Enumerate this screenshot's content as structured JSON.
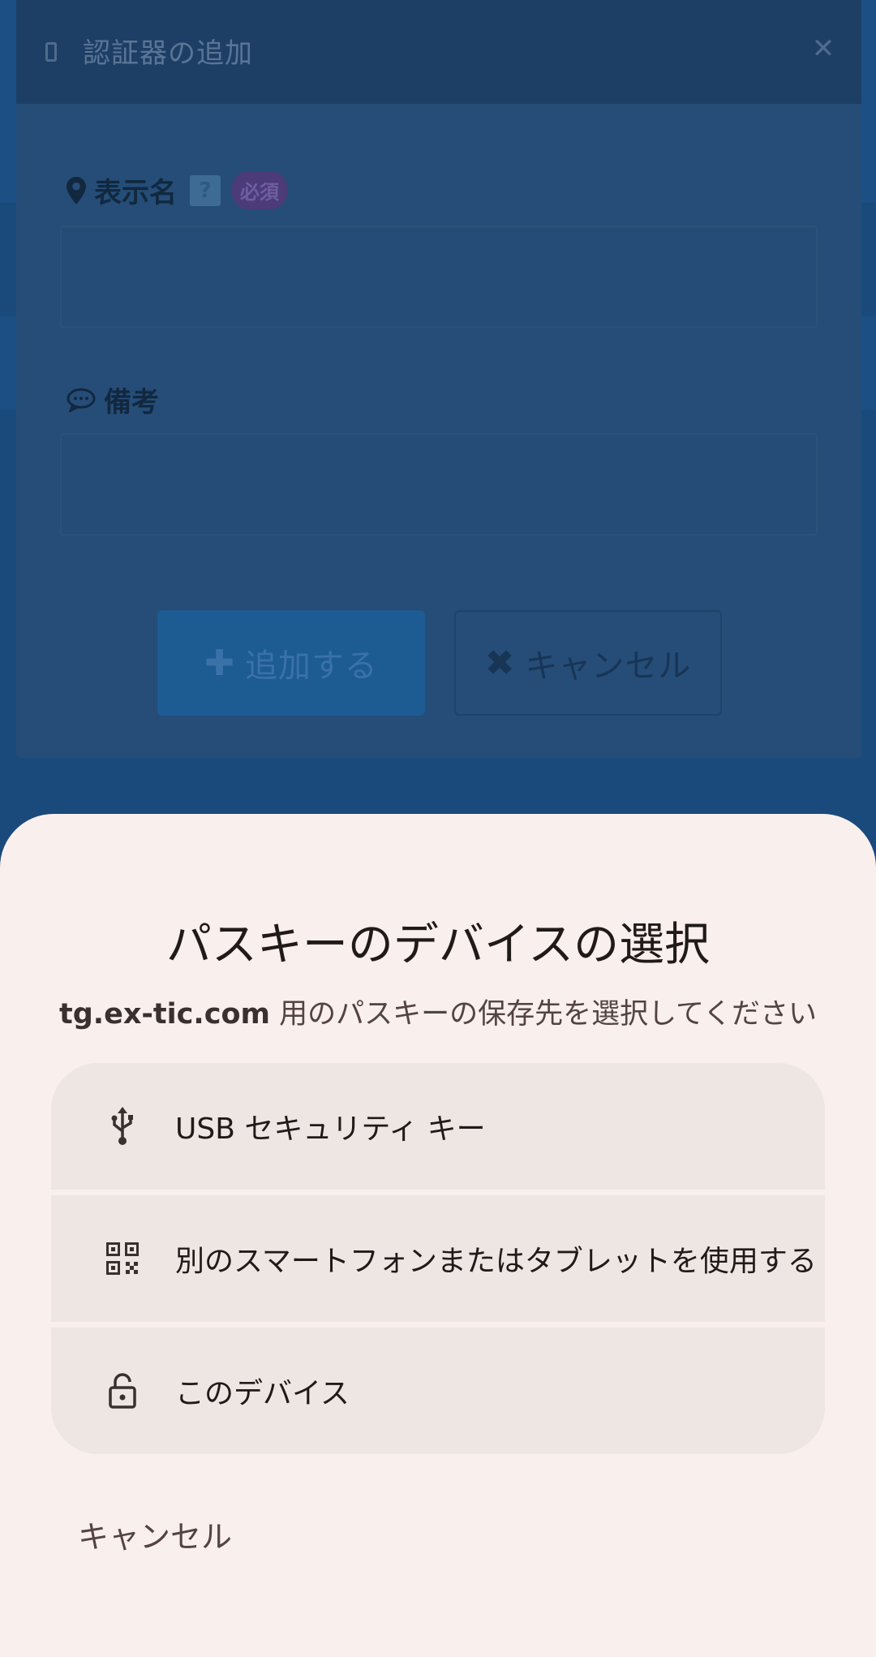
{
  "background": {
    "modal_title": "認証器の追加",
    "display_name_label": "表示名",
    "required_badge": "必須",
    "help_glyph": "?",
    "notes_label": "備考",
    "add_button": "追加する",
    "cancel_button": "キャンセル",
    "icons": [
      "phone-icon",
      "close-icon",
      "map-pin-icon",
      "help-icon",
      "chat-bubble-icon",
      "plus-icon",
      "x-icon"
    ]
  },
  "sheet": {
    "title": "パスキーのデバイスの選択",
    "subtitle_domain": "tg.ex-tic.com",
    "subtitle_rest": " 用のパスキーの保存先を選択してください",
    "options": [
      {
        "label": "USB セキュリティ キー",
        "icon": "usb-icon"
      },
      {
        "label": "別のスマートフォンまたはタブレットを使用する",
        "icon": "qr-code-icon"
      },
      {
        "label": "このデバイス",
        "icon": "lock-icon"
      }
    ],
    "cancel": "キャンセル"
  },
  "colors": {
    "scrim_page": "#1a4a7c",
    "sheet_background": "#f9efed",
    "option_background": "#ede6e2",
    "text_primary": "#201a19",
    "text_secondary": "#534341"
  }
}
